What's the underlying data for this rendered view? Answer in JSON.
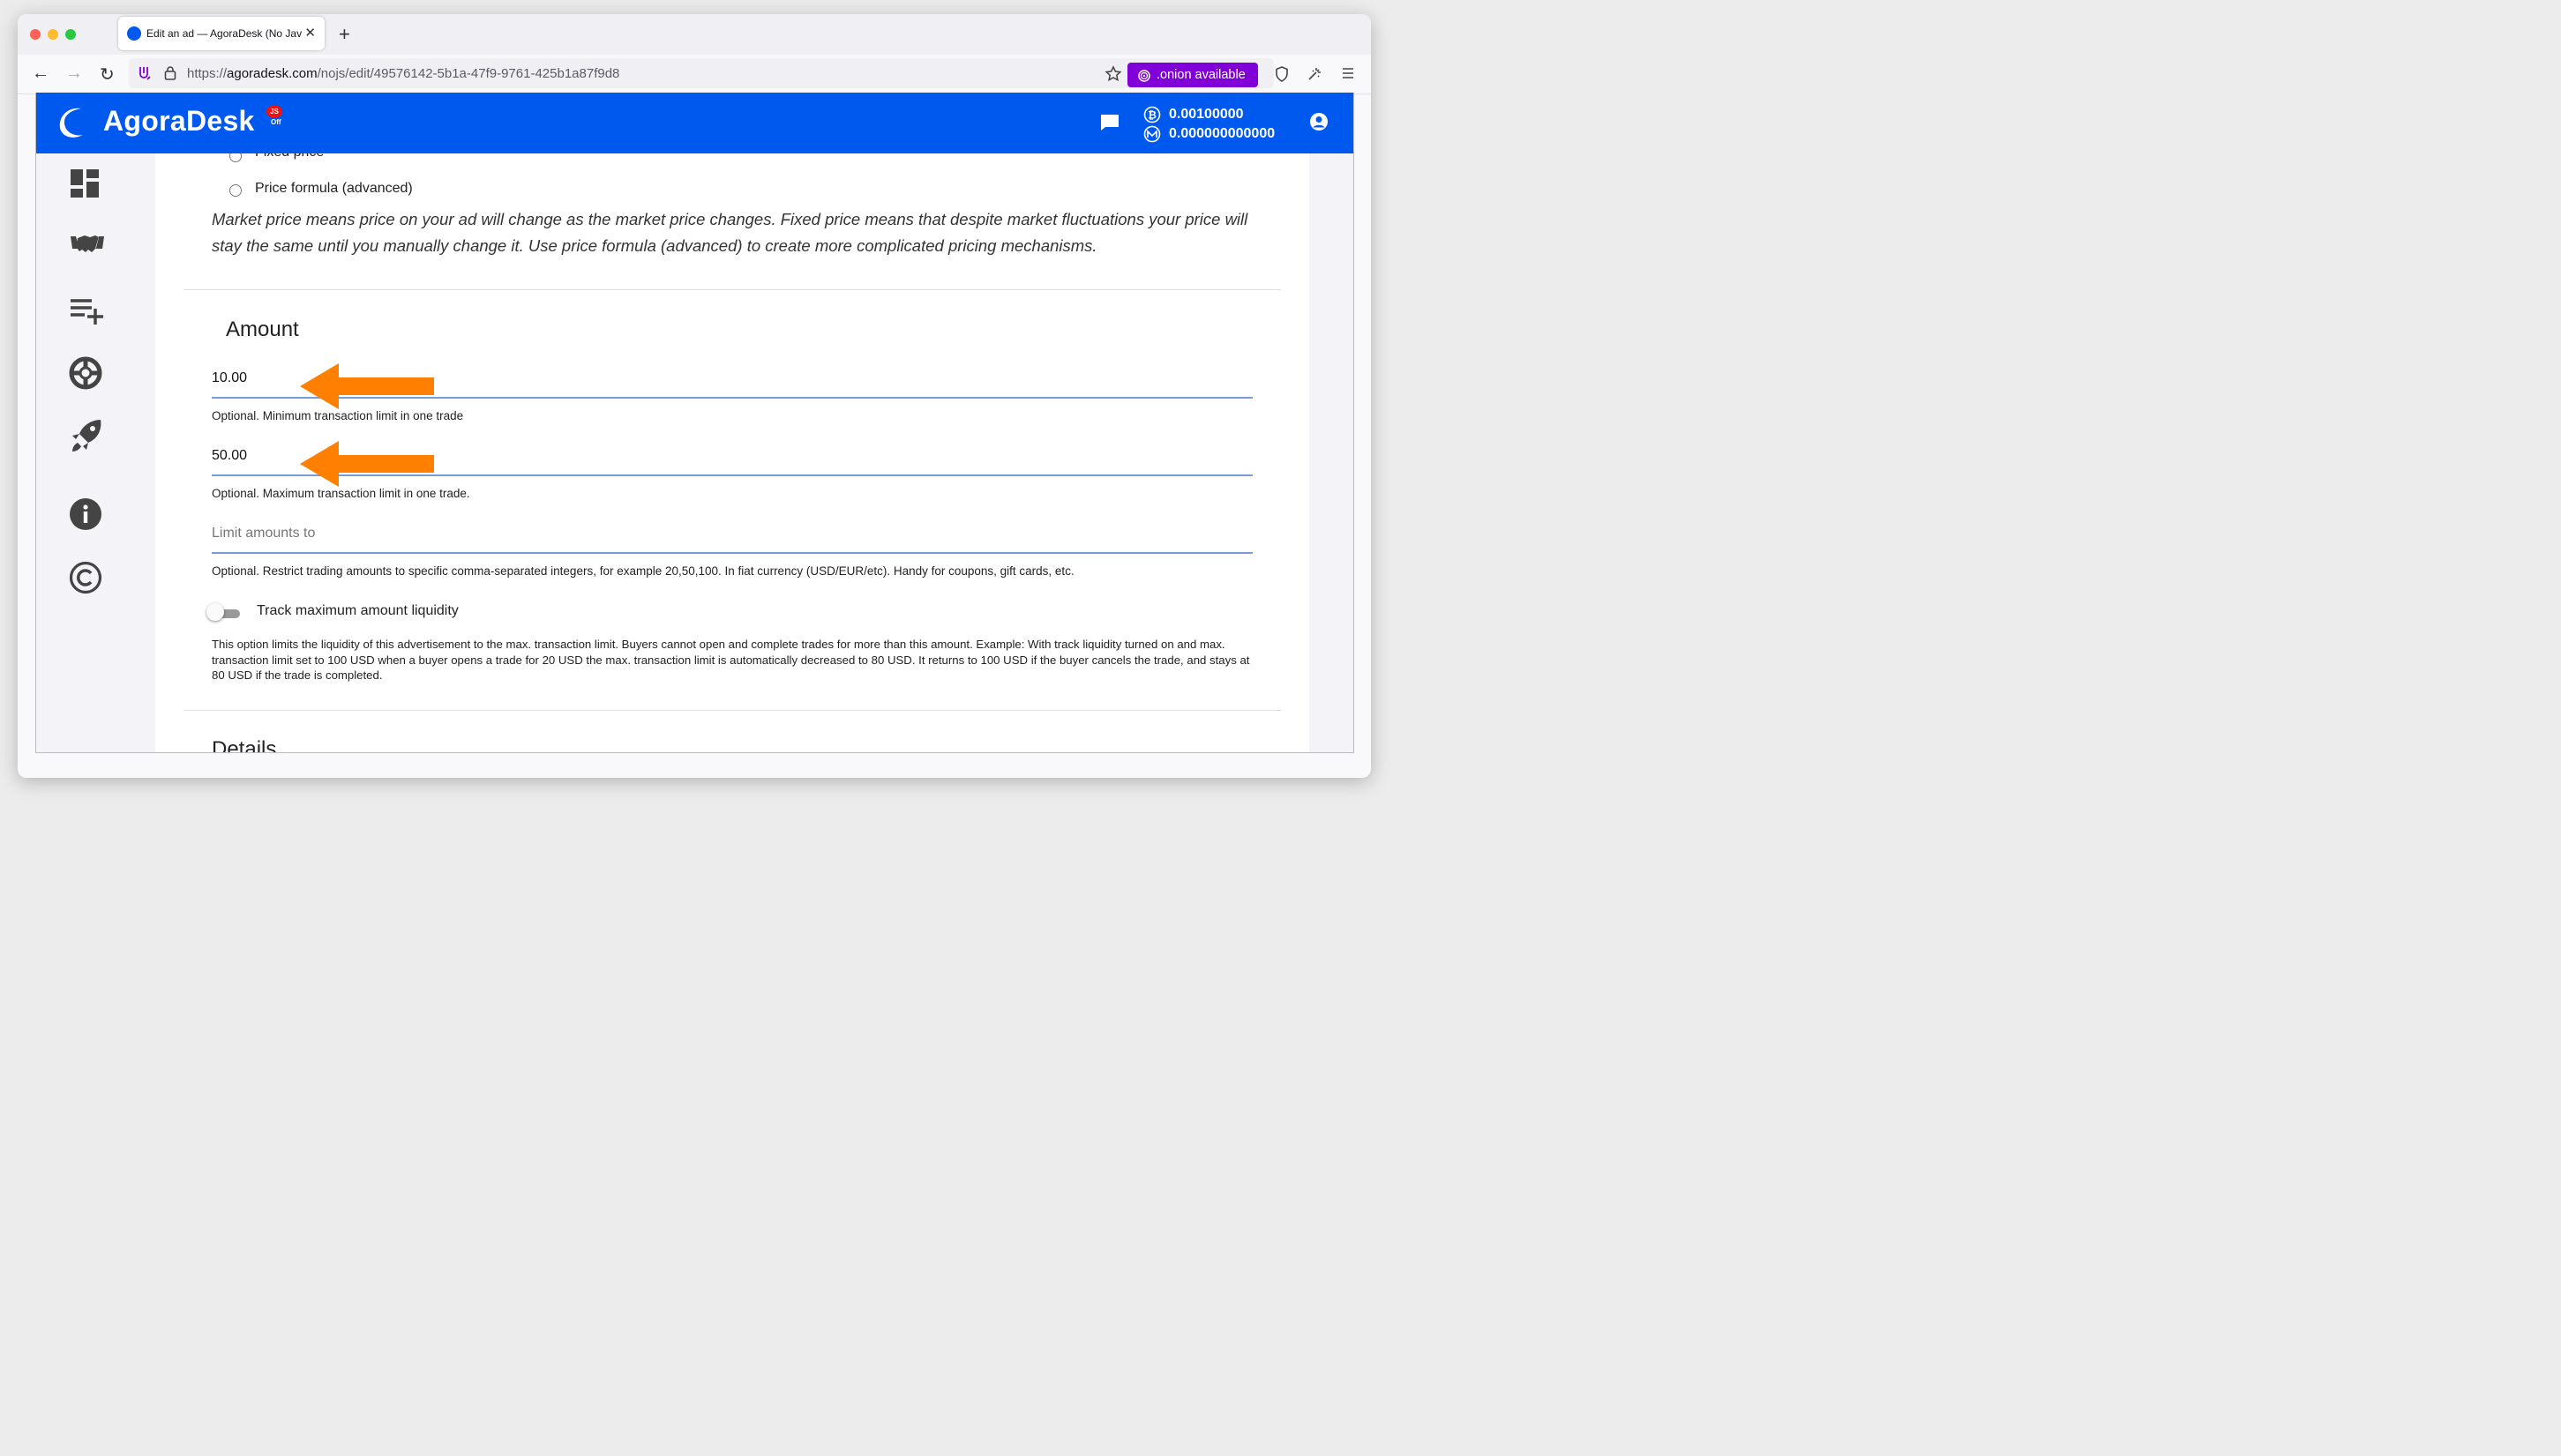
{
  "browser": {
    "tab_title": "Edit an ad — AgoraDesk (No JavaScript)",
    "url_prefix": "https://",
    "url_host": "agoradesk.com",
    "url_path": "/nojs/edit/49576142-5b1a-47f9-9761-425b1a87f9d8",
    "onion_label": ".onion available",
    "icons": [
      "back-arrow-icon",
      "forward-arrow-icon",
      "reload-icon",
      "permissions-icon",
      "lock-icon",
      "bookmark-star-icon",
      "onion-icon",
      "shield-icon",
      "extensions-icon",
      "hamburger-menu-icon"
    ]
  },
  "header": {
    "brand": "AgoraDesk",
    "js_badge_top": "JS",
    "js_badge_bottom": "Off",
    "btc_balance": "0.00100000",
    "xmr_balance": "0.000000000000"
  },
  "sidebar": {
    "items": [
      {
        "icon": "dashboard-icon"
      },
      {
        "icon": "handshake-icon"
      },
      {
        "icon": "playlist-add-icon"
      },
      {
        "icon": "lifebuoy-icon"
      },
      {
        "icon": "rocket-icon"
      },
      {
        "icon": "info-icon"
      },
      {
        "icon": "copyright-icon"
      }
    ]
  },
  "pricing": {
    "option_fixed": "Fixed price",
    "option_formula": "Price formula (advanced)",
    "description": "Market price means price on your ad will change as the market price changes. Fixed price means that despite market fluctuations your price will stay the same until you manually change it. Use price formula (advanced) to create more complicated pricing mechanisms."
  },
  "amount": {
    "title": "Amount",
    "min_value": "10.00",
    "min_help": "Optional. Minimum transaction limit in one trade",
    "max_value": "50.00",
    "max_help": "Optional. Maximum transaction limit in one trade.",
    "limit_placeholder": "Limit amounts to",
    "limit_help": "Optional. Restrict trading amounts to specific comma-separated integers, for example 20,50,100. In fiat currency (USD/EUR/etc). Handy for coupons, gift cards, etc.",
    "track_label": "Track maximum amount liquidity",
    "track_enabled": false,
    "track_help": "This option limits the liquidity of this advertisement to the max. transaction limit. Buyers cannot open and complete trades for more than this amount. Example: With track liquidity turned on and max. transaction limit set to 100 USD when a buyer opens a trade for 20 USD the max. transaction limit is automatically decreased to 80 USD. It returns to 100 USD if the buyer cancels the trade, and stays at 80 USD if the trade is completed."
  },
  "details": {
    "title": "Details"
  },
  "colors": {
    "brand_blue": "#0059ee",
    "onion_purple": "#8000d7",
    "annotation_orange": "#ff7f00",
    "field_underline": "#7a9ad8"
  }
}
